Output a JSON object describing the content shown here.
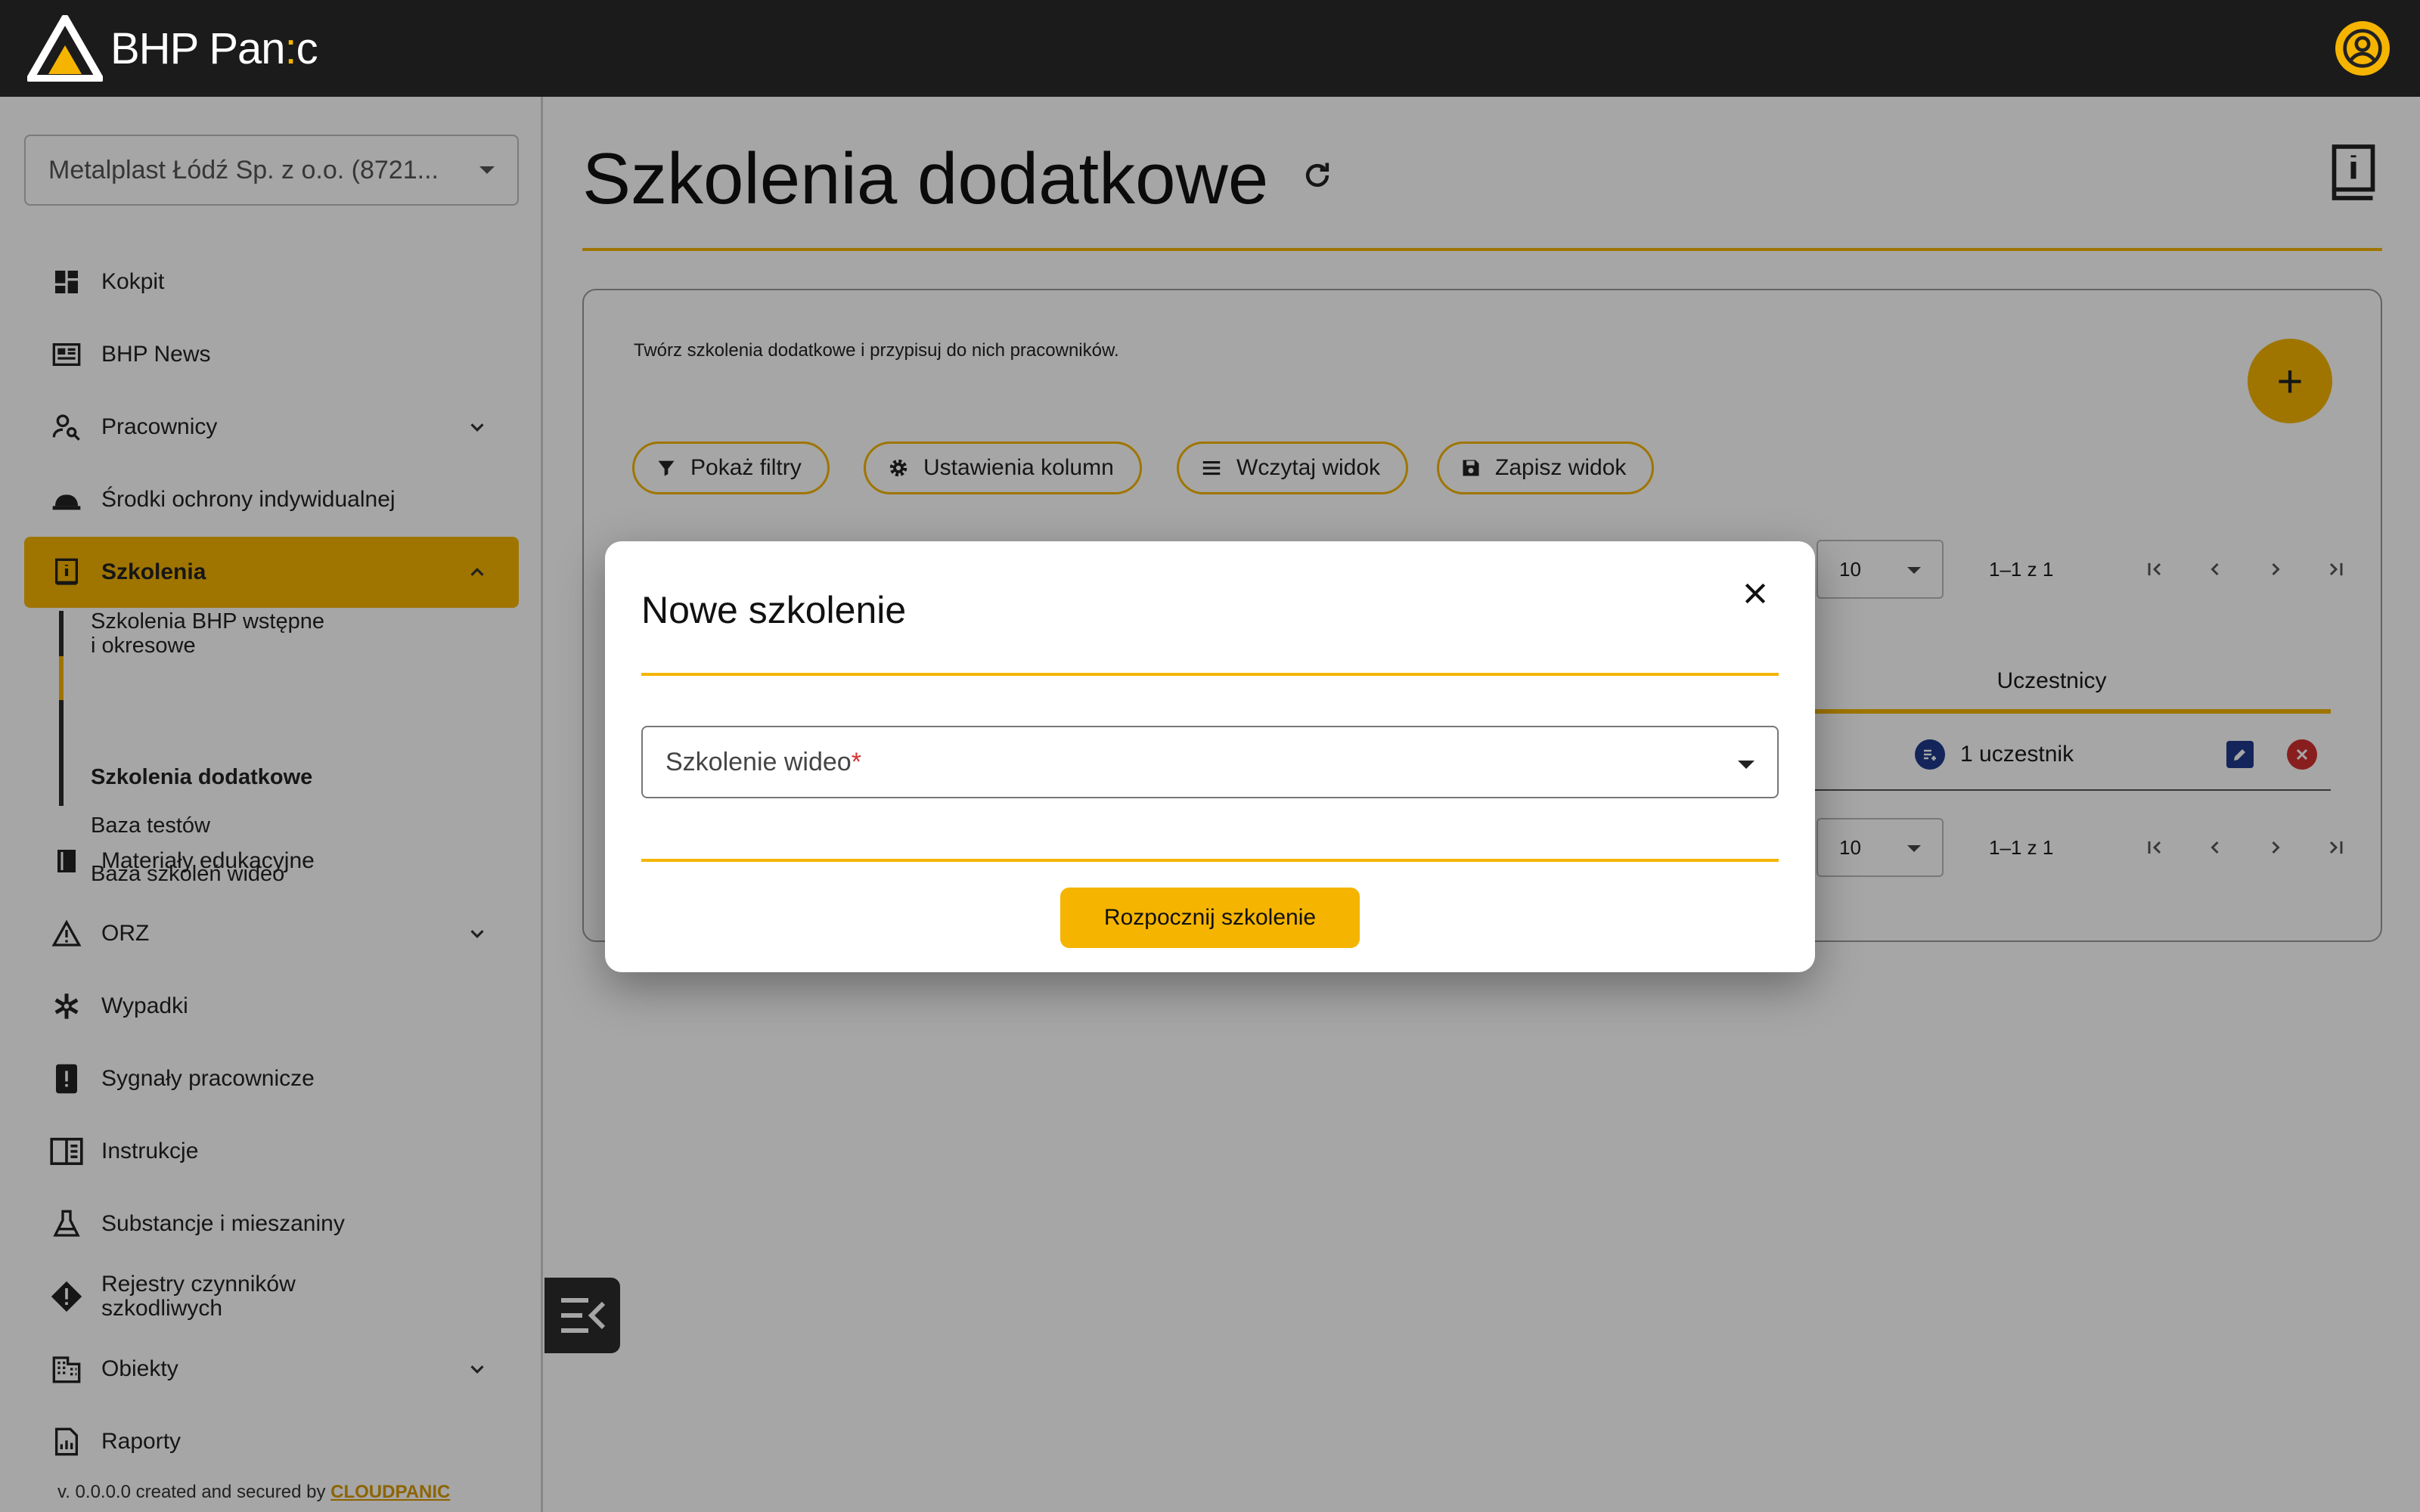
{
  "app": {
    "name_main": "BHP Pan",
    "name_accent": ":",
    "name_end": "c"
  },
  "sidebar": {
    "company": "Metalplast Łódź Sp. z o.o. (8721...",
    "items": [
      {
        "label": "Kokpit",
        "icon": "dashboard-icon"
      },
      {
        "label": "BHP News",
        "icon": "newspaper-icon"
      },
      {
        "label": "Pracownicy",
        "icon": "person-search-icon"
      },
      {
        "label": "Środki ochrony indywidualnej",
        "icon": "hard-hat-icon"
      },
      {
        "label": "Szkolenia",
        "icon": "training-book-icon"
      },
      {
        "label": "Materiały edukacyjne",
        "icon": "book-icon"
      },
      {
        "label": "ORZ",
        "icon": "risk-warning-icon"
      },
      {
        "label": "Wypadki",
        "icon": "medical-icon"
      },
      {
        "label": "Sygnały pracownicze",
        "icon": "alert-tablet-icon"
      },
      {
        "label": "Instrukcje",
        "icon": "instructions-icon"
      },
      {
        "label": "Substancje i mieszaniny",
        "icon": "flask-icon"
      },
      {
        "label": "Rejestry czynników",
        "label2": "szkodliwych",
        "icon": "danger-diamond-icon"
      },
      {
        "label": "Obiekty",
        "icon": "building-icon"
      },
      {
        "label": "Raporty",
        "icon": "report-icon"
      }
    ],
    "sub_items": [
      {
        "label": "Szkolenia BHP wstępne",
        "label2": "i okresowe"
      },
      {
        "label": "Szkolenia dodatkowe"
      },
      {
        "label": "Baza testów"
      },
      {
        "label": "Baza szkoleń wideo"
      }
    ],
    "footer_prefix": "v. 0.0.0.0 created and secured by ",
    "footer_link": "CLOUDPANIC"
  },
  "main": {
    "title": "Szkolenia dodatkowe",
    "description": "Twórz szkolenia dodatkowe i przypisuj do nich pracowników.",
    "add_label": "+",
    "chips": [
      "Pokaż filtry",
      "Ustawienia kolumn",
      "Wczytaj widok",
      "Zapisz widok"
    ],
    "rows_per_page": "10",
    "page_count": "1–1 z 1",
    "column_participants": "Uczestnicy",
    "row": {
      "participants": "1 uczestnik"
    }
  },
  "dialog": {
    "title": "Nowe szkolenie",
    "field_label": "Szkolenie wideo",
    "field_required": "*",
    "submit": "Rozpocznij szkolenie"
  },
  "colors": {
    "accent": "#f5b400",
    "topbar": "#1b1b1b",
    "blue": "#1e3a8a",
    "red": "#d32f2f"
  }
}
